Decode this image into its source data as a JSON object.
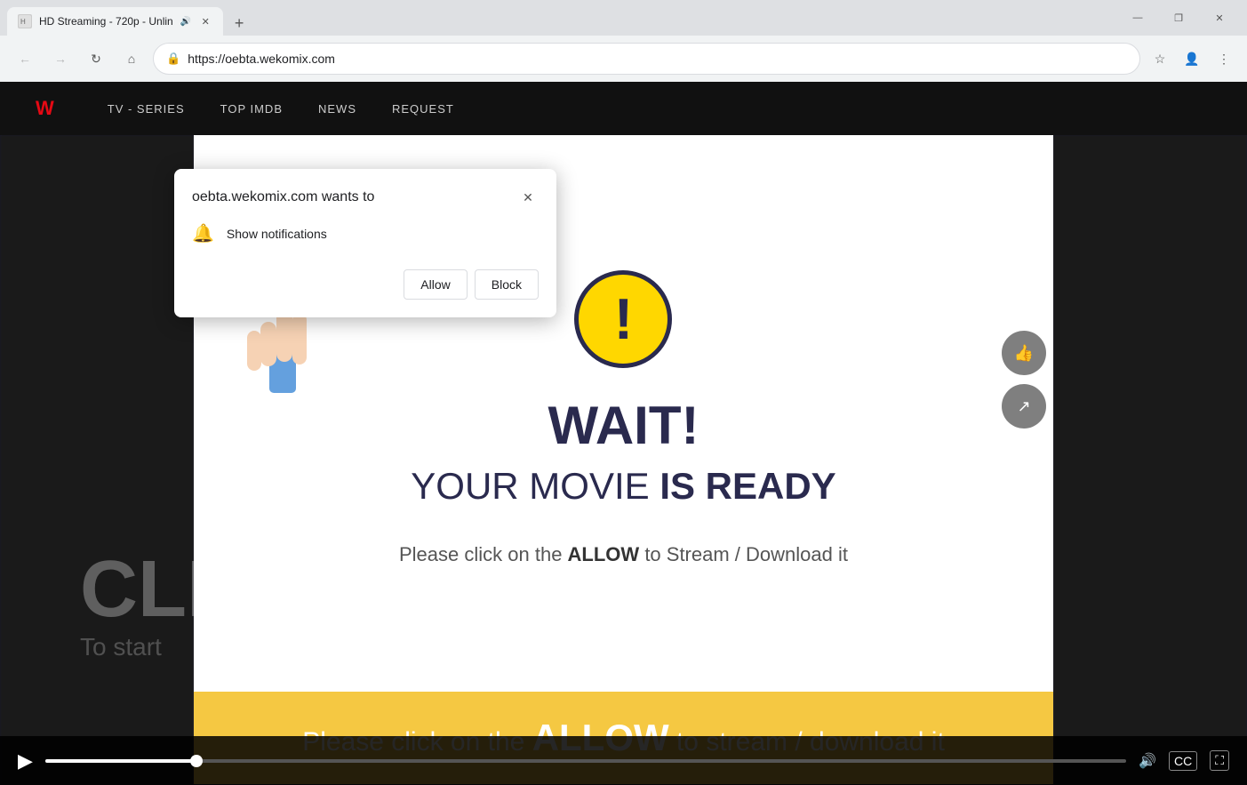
{
  "browser": {
    "tab": {
      "title": "HD Streaming - 720p - Unlin",
      "favicon_label": "page-icon",
      "has_audio": true,
      "audio_icon_label": "audio-icon"
    },
    "new_tab_label": "+",
    "window_controls": {
      "minimize_label": "—",
      "maximize_label": "❐",
      "close_label": "✕"
    },
    "nav": {
      "back_label": "←",
      "forward_label": "→",
      "reload_label": "↻",
      "home_label": "⌂"
    },
    "address_bar": {
      "lock_label": "🔒",
      "url": "https://oebta.wekomix.com",
      "bookmark_label": "☆",
      "account_label": "👤",
      "menu_label": "⋮"
    }
  },
  "site": {
    "nav_items": [
      {
        "label": "TV - SERIES"
      },
      {
        "label": "TOP IMDB"
      },
      {
        "label": "NEWS"
      },
      {
        "label": "REQUEST"
      }
    ],
    "bg_text_1": "CLI",
    "bg_text_2": "To start"
  },
  "modal": {
    "warning_symbol": "!",
    "wait_text": "WAIT!",
    "movie_ready_text_plain": "YOUR MOVIE ",
    "movie_ready_text_bold": "IS READY",
    "instruction_text_1": "Please click on the ",
    "instruction_allow": "ALLOW",
    "instruction_text_2": " to Stream / Download it"
  },
  "bottom_banner": {
    "text_1": "Please click on the ",
    "allow_text": "ALLOW",
    "text_2": " to stream / download it"
  },
  "permission_popup": {
    "site": "oebta.wekomix.com wants to",
    "bell_icon_label": "bell-icon",
    "description": "Show notifications",
    "allow_btn": "Allow",
    "block_btn": "Block",
    "close_icon_label": "close-icon"
  },
  "video_controls": {
    "play_icon_label": "play-icon",
    "volume_icon_label": "volume-icon",
    "cc_label": "CC",
    "fullscreen_icon_label": "fullscreen-icon",
    "progress_percent": 14
  }
}
